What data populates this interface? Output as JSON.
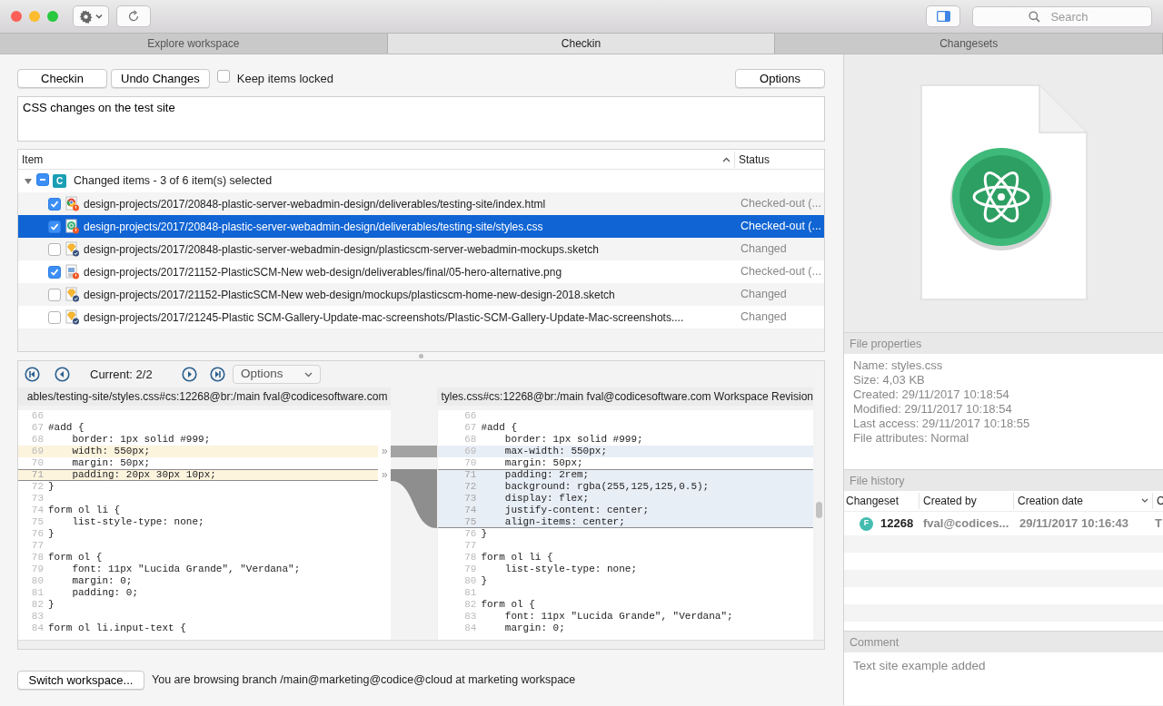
{
  "toolbar": {
    "search_placeholder": "Search"
  },
  "tabs": [
    {
      "label": "Explore workspace",
      "selected": false
    },
    {
      "label": "Checkin",
      "selected": true
    },
    {
      "label": "Changesets",
      "selected": false
    }
  ],
  "actions": {
    "checkin": "Checkin",
    "undo": "Undo Changes",
    "keep_locked": {
      "label": "Keep items locked",
      "checked": false
    },
    "options": "Options"
  },
  "comment": {
    "value": "CSS changes on the test site"
  },
  "changes": {
    "columns": [
      "Item",
      "Status"
    ],
    "group": {
      "label": "Changed items - 3 of 6 item(s) selected",
      "badge": "C",
      "expanded": true,
      "checked": true,
      "partial": true,
      "children": [
        {
          "path": "design-projects/2017/20848-plastic-server-webadmin-design/deliverables/testing-site/index.html",
          "status": "Checked-out (...",
          "kind": "html",
          "checked_out": true,
          "checked": true,
          "selected": false
        },
        {
          "path": "design-projects/2017/20848-plastic-server-webadmin-design/deliverables/testing-site/styles.css",
          "status": "Checked-out (...",
          "kind": "css",
          "checked_out": true,
          "checked": true,
          "selected": true
        },
        {
          "path": "design-projects/2017/20848-plastic-server-webadmin-design/plasticscm-server-webadmin-mockups.sketch",
          "status": "Changed",
          "kind": "sketch",
          "checked_out": false,
          "checked": false,
          "selected": false
        },
        {
          "path": "design-projects/2017/21152-PlasticSCM-New web-design/deliverables/final/05-hero-alternative.png",
          "status": "Checked-out (...",
          "kind": "image",
          "checked_out": true,
          "checked": true,
          "selected": false
        },
        {
          "path": "design-projects/2017/21152-PlasticSCM-New web-design/mockups/plasticscm-home-new-design-2018.sketch",
          "status": "Changed",
          "kind": "sketch",
          "checked_out": false,
          "checked": false,
          "selected": false
        },
        {
          "path": "design-projects/2017/21245-Plastic SCM-Gallery-Update-mac-screenshots/Plastic-SCM-Gallery-Update-Mac-screenshots....",
          "status": "Changed",
          "kind": "sketch",
          "checked_out": false,
          "checked": false,
          "selected": false
        }
      ]
    }
  },
  "diff": {
    "current": "Current: 2/2",
    "options": "Options",
    "left": {
      "header": "ables/testing-site/styles.css#cs:12268@br:/main fval@codicesoftware.com",
      "lines": [
        {
          "number": "66",
          "changed": false,
          "current": false
        },
        {
          "number": "67",
          "text": "#add {",
          "changed": false,
          "current": false
        },
        {
          "number": "68",
          "text": "    border: 1px solid #999;",
          "changed": false,
          "current": false
        },
        {
          "number": "69",
          "text": "    width: 550px;",
          "changed": true,
          "current": false,
          "merge_mark": "»"
        },
        {
          "number": "70",
          "text": "    margin: 50px;",
          "changed": false,
          "current": false
        },
        {
          "number": "71",
          "text": "    padding: 20px 30px 10px;",
          "changed": true,
          "current": true,
          "merge_mark": "»"
        },
        {
          "number": "72",
          "text": "}",
          "changed": false,
          "current": false
        },
        {
          "number": "73",
          "changed": false,
          "current": false
        },
        {
          "number": "74",
          "text": "form ol li {",
          "changed": false,
          "current": false
        },
        {
          "number": "75",
          "text": "    list-style-type: none;",
          "changed": false,
          "current": false
        },
        {
          "number": "76",
          "text": "}",
          "changed": false,
          "current": false
        },
        {
          "number": "77",
          "changed": false,
          "current": false
        },
        {
          "number": "78",
          "text": "form ol {",
          "changed": false,
          "current": false
        },
        {
          "number": "79",
          "text": "    font: 11px \"Lucida Grande\", \"Verdana\";",
          "changed": false,
          "current": false
        },
        {
          "number": "80",
          "text": "    margin: 0;",
          "changed": false,
          "current": false
        },
        {
          "number": "81",
          "text": "    padding: 0;",
          "changed": false,
          "current": false
        },
        {
          "number": "82",
          "text": "}",
          "changed": false,
          "current": false
        },
        {
          "number": "83",
          "changed": false,
          "current": false
        },
        {
          "number": "84",
          "text": "form ol li.input-text {",
          "changed": false,
          "current": false
        }
      ]
    },
    "right": {
      "header": "tyles.css#cs:12268@br:/main fval@codicesoftware.com Workspace Revision",
      "lines": [
        {
          "number": "66",
          "changed": false,
          "current": false
        },
        {
          "number": "67",
          "text": "#add {",
          "changed": false,
          "current": false
        },
        {
          "number": "68",
          "text": "    border: 1px solid #999;",
          "changed": false,
          "current": false
        },
        {
          "number": "69",
          "text": "    max-width: 550px;",
          "changed": true,
          "current": false
        },
        {
          "number": "70",
          "text": "    margin: 50px;",
          "changed": false,
          "current": false
        },
        {
          "number": "71",
          "text": "    padding: 2rem;",
          "changed": true,
          "current": true
        },
        {
          "number": "72",
          "text": "    background: rgba(255,125,125,0.5);",
          "changed": true,
          "current": true
        },
        {
          "number": "73",
          "text": "    display: flex;",
          "changed": true,
          "current": true
        },
        {
          "number": "74",
          "text": "    justify-content: center;",
          "changed": true,
          "current": true
        },
        {
          "number": "75",
          "text": "    align-items: center;",
          "changed": true,
          "current": true
        },
        {
          "number": "76",
          "text": "}",
          "changed": false,
          "current": false
        },
        {
          "number": "77",
          "changed": false,
          "current": false
        },
        {
          "number": "78",
          "text": "form ol li {",
          "changed": false,
          "current": false
        },
        {
          "number": "79",
          "text": "    list-style-type: none;",
          "changed": false,
          "current": false
        },
        {
          "number": "80",
          "text": "}",
          "changed": false,
          "current": false
        },
        {
          "number": "81",
          "changed": false,
          "current": false
        },
        {
          "number": "82",
          "text": "form ol {",
          "changed": false,
          "current": false
        },
        {
          "number": "83",
          "text": "    font: 11px \"Lucida Grande\", \"Verdana\";",
          "changed": false,
          "current": false
        },
        {
          "number": "84",
          "text": "    margin: 0;",
          "changed": false,
          "current": false
        }
      ]
    }
  },
  "status_bar": {
    "button": "Switch workspace...",
    "message": "You are browsing branch /main@marketing@codice@cloud at marketing workspace"
  },
  "file_properties": {
    "title": "File properties",
    "lines": [
      "Name: styles.css",
      "Size: 4,03 KB",
      "Created: 29/11/2017 10:18:54",
      "Modified: 29/11/2017 10:18:54",
      "Last access: 29/11/2017 10:18:55",
      "File attributes: Normal"
    ]
  },
  "file_history": {
    "title": "File history",
    "columns": [
      "Changeset",
      "Created by",
      "Creation date",
      "C"
    ],
    "rows": [
      {
        "avatar": "F",
        "changeset": "12268",
        "created_by": "fval@codices...",
        "date": "29/11/2017 10:16:43",
        "column_4": "T"
      }
    ]
  },
  "comment_panel": {
    "title": "Comment",
    "text": "Text site example added"
  }
}
